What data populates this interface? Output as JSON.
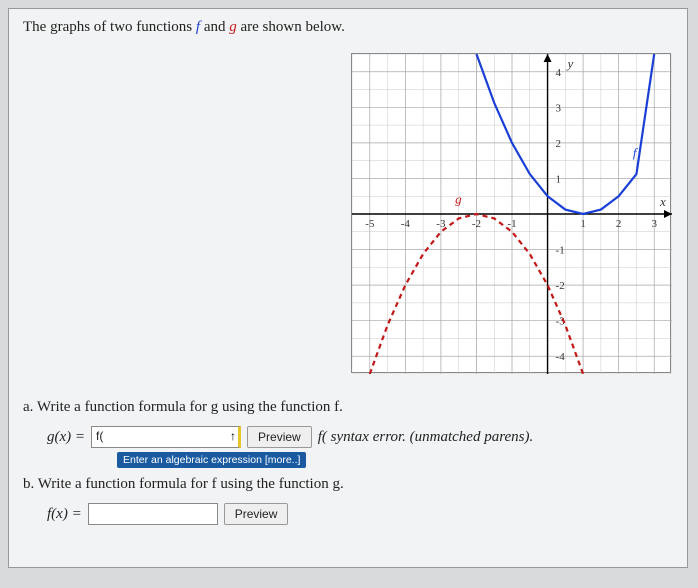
{
  "prompt": {
    "lead": "The graphs of two functions ",
    "f": "f",
    "and": " and ",
    "g": "g",
    "tail": " are shown below."
  },
  "chart_data": {
    "type": "line",
    "xlabel": "x",
    "ylabel": "y",
    "xlim": [
      -5.5,
      3.5
    ],
    "ylim": [
      -4.5,
      4.5
    ],
    "x_ticks": [
      -5,
      -4,
      -3,
      -2,
      -1,
      1,
      2,
      3
    ],
    "y_ticks": [
      -4,
      -3,
      -2,
      -1,
      1,
      2,
      3,
      4
    ],
    "series": [
      {
        "name": "f",
        "color": "#1a3fd6",
        "style": "solid",
        "x": [
          -2,
          -1.5,
          -1,
          -0.5,
          0,
          0.5,
          1,
          1.5,
          2,
          2.5,
          3
        ],
        "y": [
          4.5,
          3.125,
          2,
          1.125,
          0.5,
          0.125,
          0,
          0.125,
          0.5,
          1.125,
          4.5
        ]
      },
      {
        "name": "g",
        "color": "#c21818",
        "style": "dashed",
        "x": [
          -5,
          -4.5,
          -4,
          -3.5,
          -3,
          -2.5,
          -2,
          -1.5,
          -1,
          -0.5,
          0,
          0.5,
          1
        ],
        "y": [
          -4.5,
          -3.125,
          -2,
          -1.125,
          -0.5,
          -0.125,
          0,
          -0.125,
          -0.5,
          -1.125,
          -2,
          -3.125,
          -4.5
        ]
      }
    ],
    "curve_labels": {
      "f": "f",
      "g": "g",
      "x": "x",
      "y": "y"
    }
  },
  "parts": {
    "a": "a. Write a function formula for g using the function f.",
    "b": "b. Write a function formula for f using the function g."
  },
  "inputs": {
    "g_lhs": "g(x) =",
    "g_value": "f(",
    "g_cursor": "↑",
    "f_lhs": "f(x) =",
    "f_value": ""
  },
  "buttons": {
    "preview": "Preview"
  },
  "feedback": {
    "g": "f( syntax error. (unmatched parens)."
  },
  "tooltip": "Enter an algebraic expression [more..]"
}
